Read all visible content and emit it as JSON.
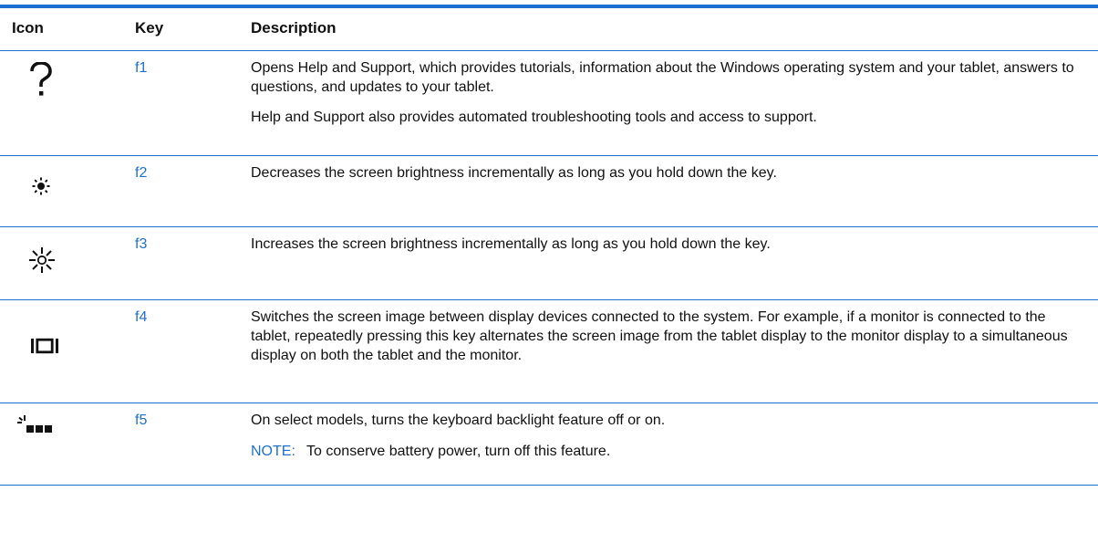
{
  "table": {
    "headers": {
      "icon": "Icon",
      "key": "Key",
      "description": "Description"
    },
    "rows": [
      {
        "icon": "help-question-mark-icon",
        "key": "f1",
        "paragraphs": [
          "Opens Help and Support, which provides tutorials, information about the Windows operating system and your tablet, answers to questions, and updates to your tablet.",
          "Help and Support also provides automated troubleshooting tools and access to support."
        ]
      },
      {
        "icon": "brightness-down-icon",
        "key": "f2",
        "paragraphs": [
          "Decreases the screen brightness incrementally as long as you hold down the key."
        ]
      },
      {
        "icon": "brightness-up-icon",
        "key": "f3",
        "paragraphs": [
          "Increases the screen brightness incrementally as long as you hold down the key."
        ]
      },
      {
        "icon": "display-switch-icon",
        "key": "f4",
        "paragraphs": [
          "Switches the screen image between display devices connected to the system. For example, if a monitor is connected to the tablet, repeatedly pressing this key alternates the screen image from the tablet display to the monitor display to a simultaneous display on both the tablet and the monitor."
        ]
      },
      {
        "icon": "keyboard-backlight-icon",
        "key": "f5",
        "paragraphs": [
          "On select models, turns the keyboard backlight feature off or on."
        ],
        "note": {
          "label": "NOTE:",
          "text": "To conserve battery power, turn off this feature."
        }
      }
    ]
  },
  "colors": {
    "accent": "#1f6fd1",
    "text": "#111111"
  }
}
